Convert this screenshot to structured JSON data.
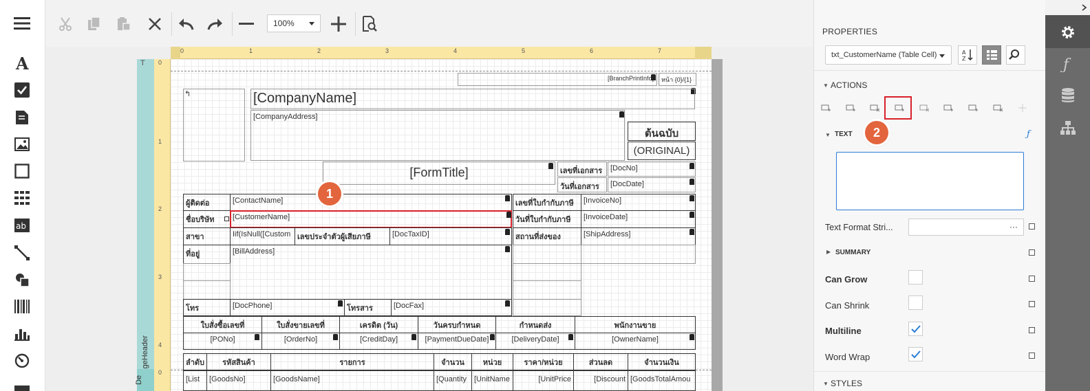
{
  "toolbar": {
    "zoom_value": "100%"
  },
  "report": {
    "company_name": "[CompanyName]",
    "company_address": "[CompanyAddress]",
    "branch_print": "[BranchPrintInfo]",
    "page_info": "หน้า {0}/{1}",
    "copy_label_th": "ต้นฉบับ",
    "copy_label_en": "(ORIGINAL)",
    "form_title": "[FormTitle]",
    "doc_no_label": "เลขที่เอกสาร",
    "doc_no": "[DocNo]",
    "doc_date_label": "วันที่เอกสาร",
    "doc_date": "[DocDate]",
    "contact_label": "ผู้ติดต่อ",
    "contact_name": "[ContactName]",
    "customer_label": "ชื่อบริษัท",
    "customer_name": "[CustomerName]",
    "branch_label": "สาขา",
    "branch_value": "Iif(IsNull([Custom",
    "tax_id_label": "เลขประจำตัวผู้เสียภาษี",
    "tax_id": "[DocTaxID]",
    "address_label": "ที่อยู่",
    "bill_address": "[BillAddress]",
    "phone_label": "โทร",
    "phone": "[DocPhone]",
    "fax_label": "โทรสาร",
    "fax": "[DocFax]",
    "invoice_no_label": "เลขที่ใบกำกับภาษี",
    "invoice_no": "[InvoiceNo]",
    "invoice_date_label": "วันที่ใบกำกับภาษี",
    "invoice_date": "[InvoiceDate]",
    "ship_label": "สถานที่ส่งของ",
    "ship_address": "[ShipAddress]",
    "info_headers": [
      "ใบสั่งซื้อเลขที่",
      "ใบสั่งขายเลขที่",
      "เครดิต (วัน)",
      "วันครบกำหนด",
      "กำหนดส่ง",
      "พนักงานขาย"
    ],
    "info_values": [
      "[PONo]",
      "[OrderNo]",
      "[CreditDay]",
      "[PaymentDueDate]",
      "[DeliveryDate]",
      "[OwnerName]"
    ],
    "item_headers": [
      "ลำดับ",
      "รหัสสินค้า",
      "รายการ",
      "จำนวน",
      "หน่วย",
      "ราคา/หน่วย",
      "ส่วนลด",
      "จำนวนเงิน"
    ],
    "item_values": [
      "[List",
      "[GoodsNo]",
      "[GoodsName]",
      "[Quantity",
      "[UnitName",
      "[UnitPrice",
      "[Discount",
      "[GoodsTotalAmou"
    ],
    "band_page_header": "PageHeader",
    "band_detail": "De",
    "band_top": "T",
    "ruler_h": [
      "0",
      "1",
      "2",
      "3",
      "4",
      "5",
      "6",
      "7"
    ],
    "ruler_v": [
      "0",
      "1",
      "2",
      "3",
      "4",
      "0"
    ]
  },
  "panel": {
    "title": "PROPERTIES",
    "selector_value": "txt_CustomerName (Table Cell)",
    "actions_label": "ACTIONS",
    "text_label": "TEXT",
    "text_value": "",
    "text_format_label": "Text Format Stri...",
    "text_format_dots": "···",
    "summary_label": "SUMMARY",
    "can_grow_label": "Can Grow",
    "can_shrink_label": "Can Shrink",
    "multiline_label": "Multiline",
    "word_wrap_label": "Word Wrap",
    "styles_label": "STYLES",
    "can_grow": false,
    "can_shrink": false,
    "multiline": true,
    "word_wrap": true
  },
  "callouts": {
    "one": "1",
    "two": "2"
  },
  "colors": {
    "callout": "#e3653d",
    "highlight": "#d9202a",
    "ruler": "#fbe7a4",
    "band": "#a8d9d7",
    "sidebar": "#6b6b6b",
    "accent_blue": "#2b7bd6"
  }
}
